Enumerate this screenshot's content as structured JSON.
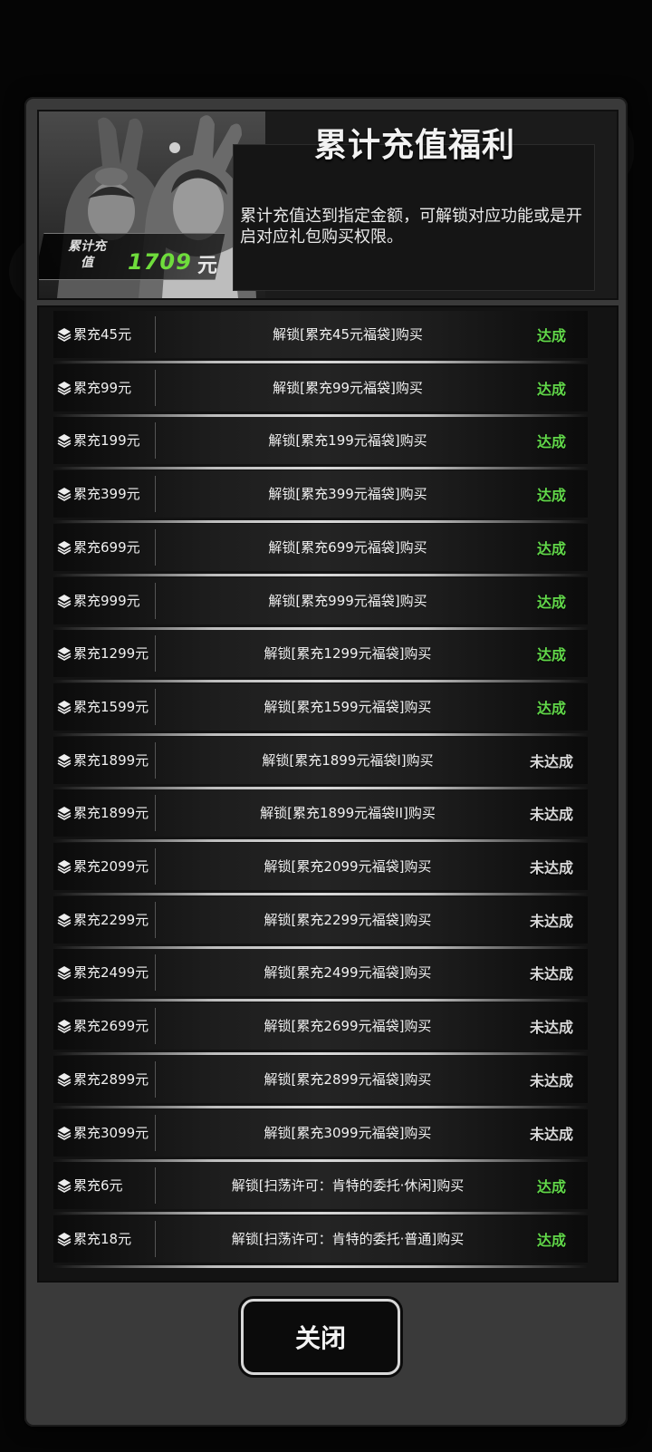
{
  "header": {
    "title": "累计充值福利",
    "description": "累计充值达到指定金额，可解锁对应功能或是开启对应礼包购买权限。",
    "amount_label": "累计充值",
    "amount_value": "1709",
    "amount_unit": "元"
  },
  "rows": [
    {
      "left": "累充45元",
      "middle": "解锁[累充45元福袋]购买",
      "status": "达成",
      "achieved": true
    },
    {
      "left": "累充99元",
      "middle": "解锁[累充99元福袋]购买",
      "status": "达成",
      "achieved": true
    },
    {
      "left": "累充199元",
      "middle": "解锁[累充199元福袋]购买",
      "status": "达成",
      "achieved": true
    },
    {
      "left": "累充399元",
      "middle": "解锁[累充399元福袋]购买",
      "status": "达成",
      "achieved": true
    },
    {
      "left": "累充699元",
      "middle": "解锁[累充699元福袋]购买",
      "status": "达成",
      "achieved": true
    },
    {
      "left": "累充999元",
      "middle": "解锁[累充999元福袋]购买",
      "status": "达成",
      "achieved": true
    },
    {
      "left": "累充1299元",
      "middle": "解锁[累充1299元福袋]购买",
      "status": "达成",
      "achieved": true
    },
    {
      "left": "累充1599元",
      "middle": "解锁[累充1599元福袋]购买",
      "status": "达成",
      "achieved": true
    },
    {
      "left": "累充1899元",
      "middle": "解锁[累充1899元福袋I]购买",
      "status": "未达成",
      "achieved": false
    },
    {
      "left": "累充1899元",
      "middle": "解锁[累充1899元福袋II]购买",
      "status": "未达成",
      "achieved": false
    },
    {
      "left": "累充2099元",
      "middle": "解锁[累充2099元福袋]购买",
      "status": "未达成",
      "achieved": false
    },
    {
      "left": "累充2299元",
      "middle": "解锁[累充2299元福袋]购买",
      "status": "未达成",
      "achieved": false
    },
    {
      "left": "累充2499元",
      "middle": "解锁[累充2499元福袋]购买",
      "status": "未达成",
      "achieved": false
    },
    {
      "left": "累充2699元",
      "middle": "解锁[累充2699元福袋]购买",
      "status": "未达成",
      "achieved": false
    },
    {
      "left": "累充2899元",
      "middle": "解锁[累充2899元福袋]购买",
      "status": "未达成",
      "achieved": false
    },
    {
      "left": "累充3099元",
      "middle": "解锁[累充3099元福袋]购买",
      "status": "未达成",
      "achieved": false
    },
    {
      "left": "累充6元",
      "middle": "解锁[扫荡许可：肯特的委托·休闲]购买",
      "status": "达成",
      "achieved": true
    },
    {
      "left": "累充18元",
      "middle": "解锁[扫荡许可：肯特的委托·普通]购买",
      "status": "达成",
      "achieved": true
    }
  ],
  "close_label": "关闭",
  "colors": {
    "achieved": "#62d84a",
    "not_achieved": "#d9d9d9",
    "amount": "#6fdc3c"
  },
  "icons": {
    "row_icon": "layers-icon"
  }
}
